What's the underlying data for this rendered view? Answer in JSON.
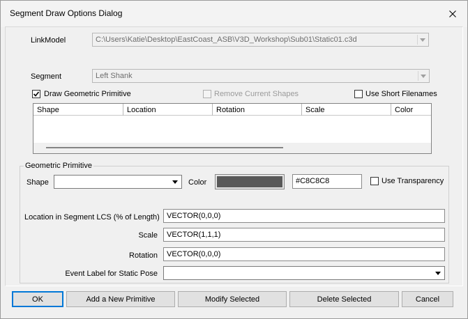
{
  "window": {
    "title": "Segment Draw Options Dialog"
  },
  "link_model": {
    "label": "LinkModel",
    "value": "C:\\Users\\Katie\\Desktop\\EastCoast_ASB\\V3D_Workshop\\Sub01\\Static01.c3d"
  },
  "segment": {
    "label": "Segment",
    "value": "Left Shank"
  },
  "options": {
    "draw_geometric_primitive": "Draw Geometric Primitive",
    "remove_current_shapes": "Remove Current Shapes",
    "use_short_filenames": "Use Short Filenames"
  },
  "list_columns": [
    "Shape",
    "Location",
    "Rotation",
    "Scale",
    "Color"
  ],
  "geometric_primitive": {
    "group_title": "Geometric Primitive",
    "shape_label": "Shape",
    "shape_value": "",
    "color_label": "Color",
    "color_swatch": "#595959",
    "color_value": "#C8C8C8",
    "use_transparency": "Use Transparency",
    "location_label": "Location in Segment LCS (% of Length)",
    "location_value": "VECTOR(0,0,0)",
    "scale_label": "Scale",
    "scale_value": "VECTOR(1,1,1)",
    "rotation_label": "Rotation",
    "rotation_value": "VECTOR(0,0,0)",
    "event_label": "Event Label for Static Pose",
    "event_value": ""
  },
  "buttons": {
    "ok": "OK",
    "add": "Add a New Primitive",
    "modify": "Modify Selected",
    "delete": "Delete Selected",
    "cancel": "Cancel"
  }
}
